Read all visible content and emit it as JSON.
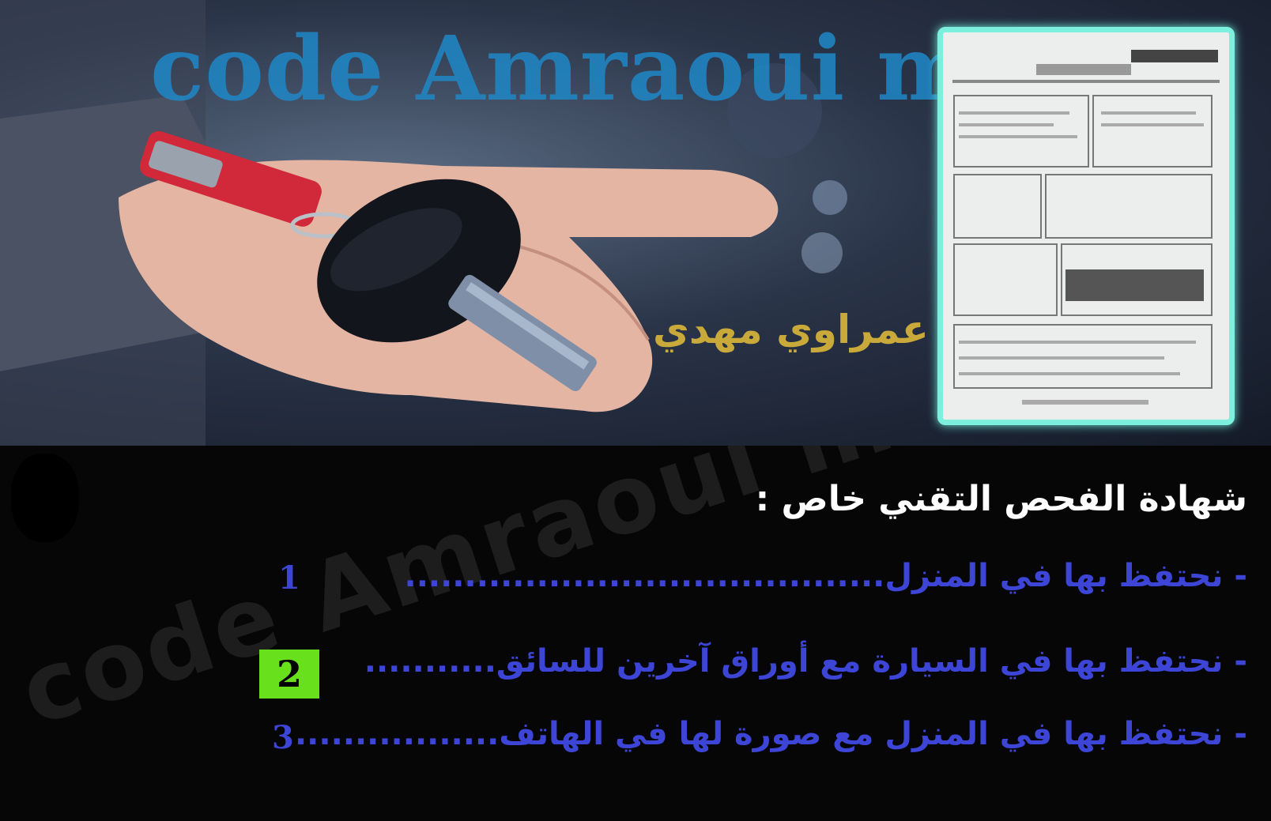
{
  "header": {
    "watermark_text": "code Amraoui mehdi",
    "arabic_name": "كود عمراوي مهدي"
  },
  "question": {
    "title": "شهادة الفحص التقني خاص :",
    "options": [
      {
        "text": "- نحتفظ بها في المنزل",
        "dots": "........................................",
        "number": "1",
        "selected": false
      },
      {
        "text": "- نحتفظ بها في السيارة مع أوراق آخرين للسائق",
        "dots": "...........",
        "number": "2",
        "selected": true
      },
      {
        "text": "- نحتفظ بها في المنزل مع صورة لها في الهاتف",
        "dots": ".................",
        "number": "3",
        "selected": false
      }
    ]
  },
  "footer": {
    "watermark_text": "code Amraoui mehdi"
  },
  "colors": {
    "option_text": "#3d45d6",
    "highlight": "#69e01c",
    "doc_border": "#7cf0dc",
    "title": "#ffffff"
  }
}
